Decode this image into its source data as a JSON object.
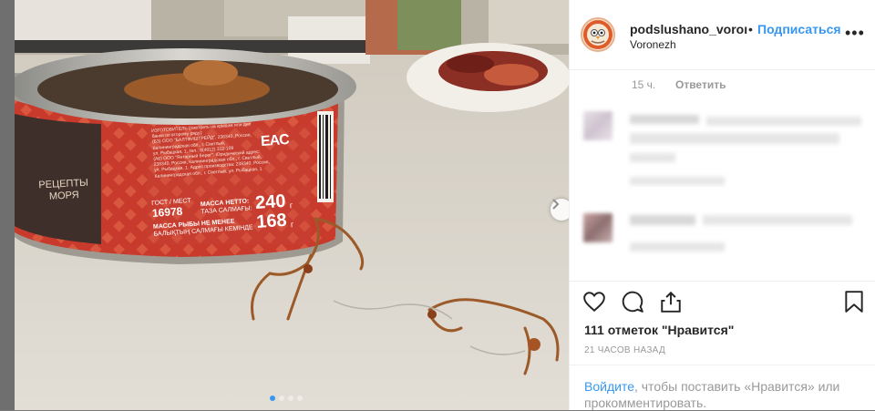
{
  "post": {
    "username": "podslushano_voroı",
    "separator": "•",
    "follow_label": "Подписаться",
    "location": "Voronezh",
    "more_label": "•••"
  },
  "comment_meta": {
    "age": "15 ч.",
    "reply_label": "Ответить"
  },
  "likes": "111 отметок \"Нравится\"",
  "timestamp": "21 ЧАСОВ НАЗАД",
  "login": {
    "link": "Войдите",
    "text": ", чтобы поставить «Нравится» или прокомментировать."
  },
  "can_label": {
    "brand_line1": "РЕЦЕПТЫ",
    "brand_line2": "МОРЯ",
    "gost": "ГОСТ / МЕСТ",
    "gost_number": "16978",
    "mass_label": "МАССА НЕТТО:",
    "mass_value": "240",
    "mass_unit": "г",
    "tara": "ТАЗА САЛМАҒЫ:",
    "fish_label": "МАССА РЫБЫ НЕ МЕНЕЕ",
    "fish_value": "168",
    "fish_unit": "г",
    "kz_line": "БАЛЫҚТЫҢ САЛМАҒЫ КЕМІНДЕ",
    "eac": "EAC",
    "maker_line1": "ИЗГОТОВИТЕЛЬ (смотреть на крышке или дне",
    "maker_line2": "банки по второму ряду):",
    "maker_line3": "(БЗ) ООО \"БАЛТФИШТРЕЙД\", 238340, Россия,",
    "maker_line4": "Калининградская обл., г. Светлый,",
    "maker_line5": "ул. Рыбацкая, 1, тел.: 8(4012) 312-109",
    "maker_line6": "(А6) ООО \"Янтарный Берег\". Юридический адрес:",
    "maker_line7": "238340, Россия, Калининградская обл., г. Светлый,",
    "maker_line8": "ул. Рыбацкая, 1. Адрес производства: 238340, Россия,",
    "maker_line9": "Калининградская обл., г. Светлый, ул. Рыбацкая, 1"
  },
  "photo": {
    "slides": 4,
    "active_slide": 0
  },
  "colors": {
    "link_blue": "#3897f0",
    "label_red": "#c73a2c",
    "text_dark": "#262626",
    "text_grey": "#999999"
  }
}
